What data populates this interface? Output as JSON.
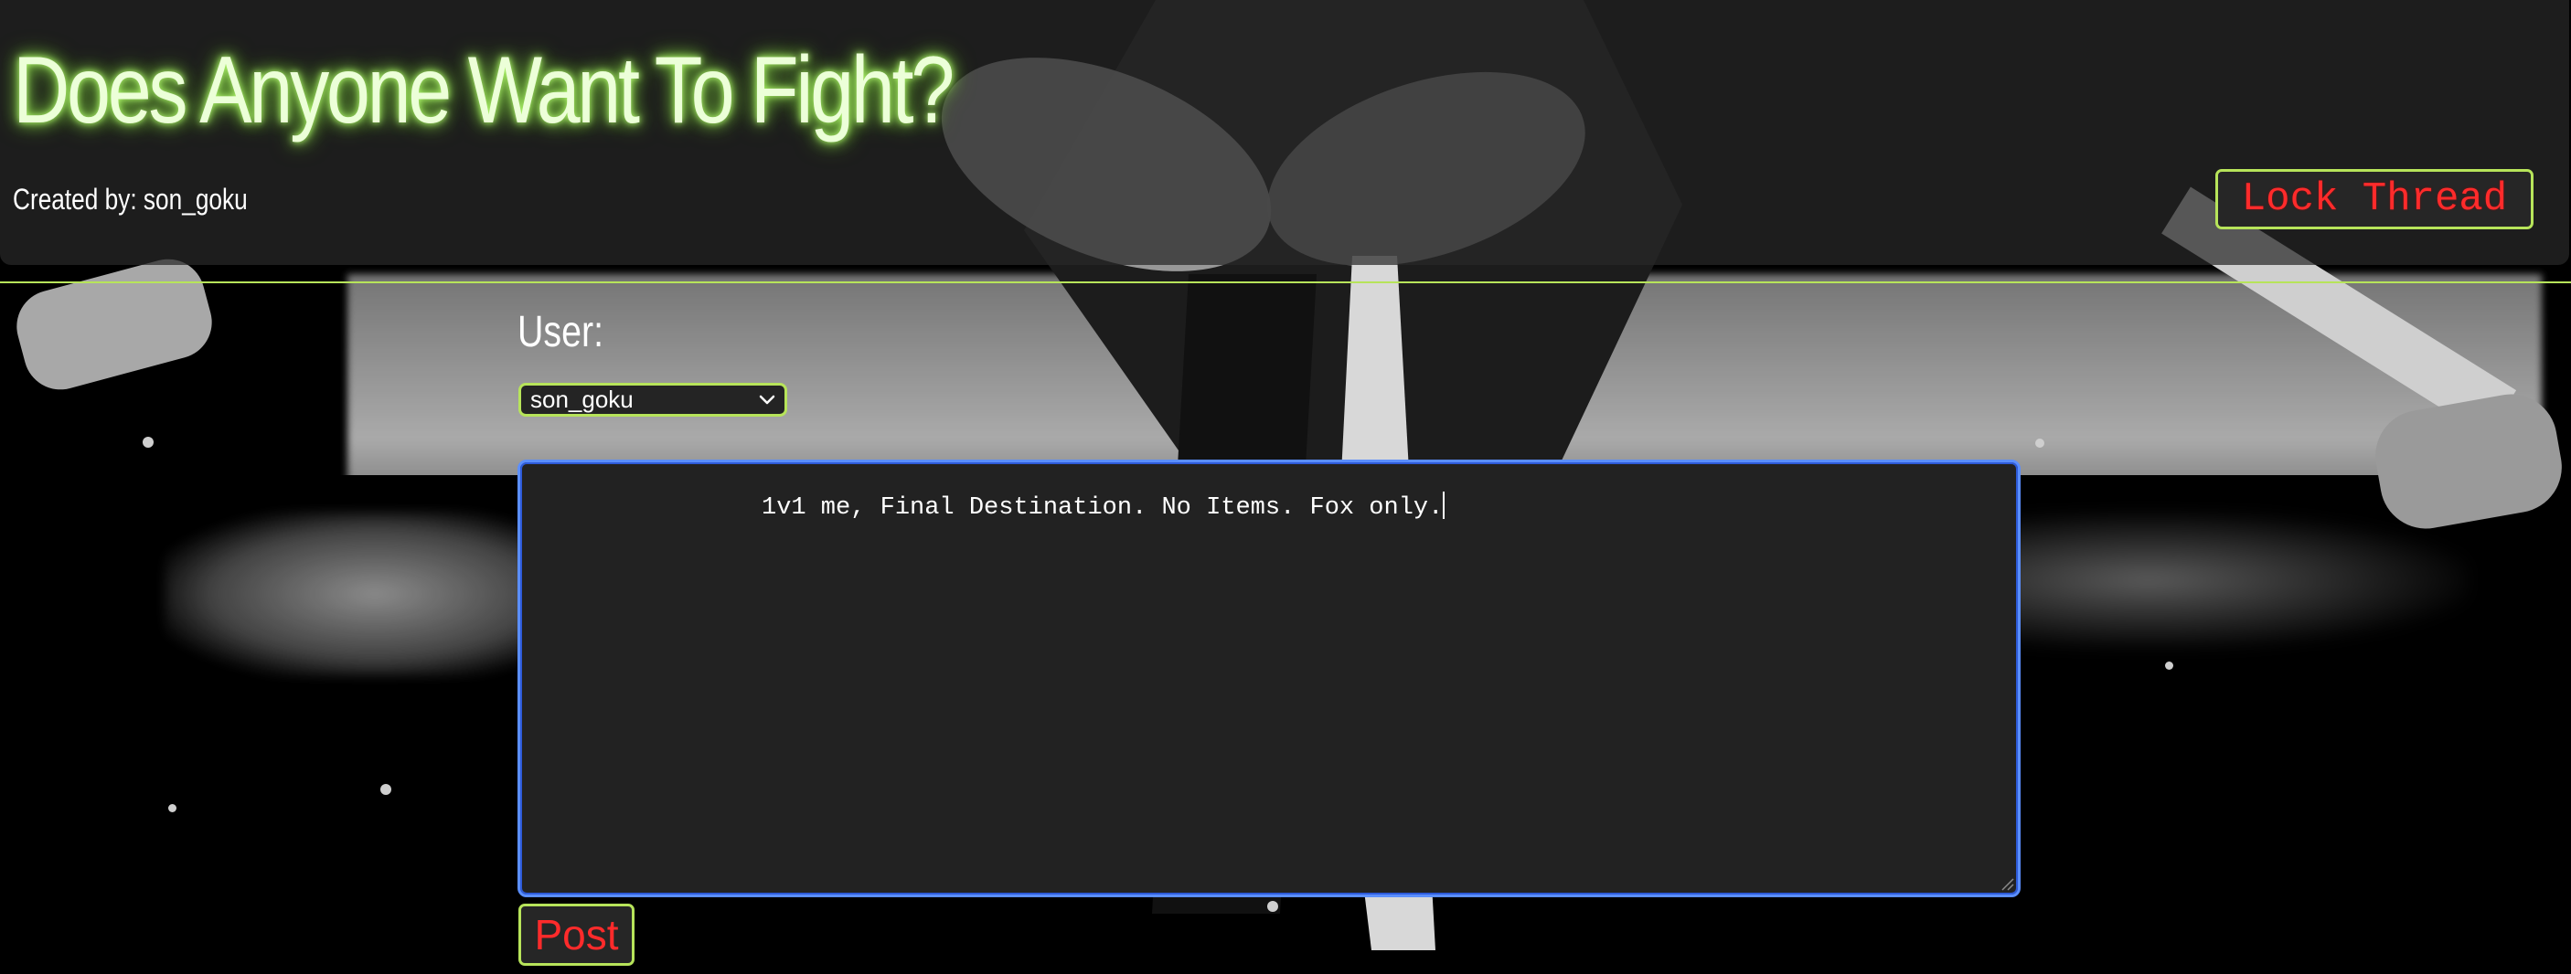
{
  "thread": {
    "title": "Does Anyone Want To Fight?",
    "creator_text": "Created by: son_goku",
    "lock_label": "Lock Thread"
  },
  "form": {
    "user_label": "User:",
    "selected_user": "son_goku",
    "message_text": "1v1 me, Final Destination. No Items. Fox only.",
    "post_label": "Post"
  },
  "icons": {
    "select_arrow": "chevron-down-icon",
    "resize": "resize-grip-icon"
  },
  "colors": {
    "accent_green": "#b7e45a",
    "title_glow": "#8ee04d",
    "button_text_red": "#ff2b2b",
    "focus_blue": "#5b8fff",
    "panel_bg": "#222222"
  }
}
